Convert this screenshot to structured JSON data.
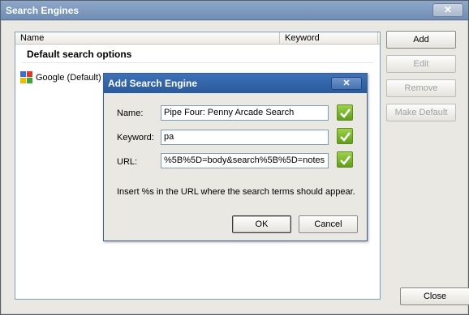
{
  "window": {
    "title": "Search Engines",
    "close_glyph": "✕"
  },
  "list": {
    "columns": [
      "Name",
      "Keyword"
    ],
    "group_label": "Default search options",
    "rows": [
      {
        "name": "Google (Default)",
        "icon": "google-icon"
      }
    ]
  },
  "side_buttons": {
    "add": "Add",
    "edit": "Edit",
    "remove": "Remove",
    "make_default": "Make Default"
  },
  "close_button": "Close",
  "dialog": {
    "title": "Add Search Engine",
    "close_glyph": "✕",
    "name_label": "Name:",
    "name_value": "Pipe Four: Penny Arcade Search",
    "keyword_label": "Keyword:",
    "keyword_value": "pa",
    "url_label": "URL:",
    "url_value": "%5B%5D=body&search%5B%5D=notes",
    "hint": "Insert %s in the URL where the search terms should appear.",
    "ok": "OK",
    "cancel": "Cancel"
  },
  "colors": {
    "check_green": "#6fb52a",
    "title_blue": "#2a5a9e"
  }
}
